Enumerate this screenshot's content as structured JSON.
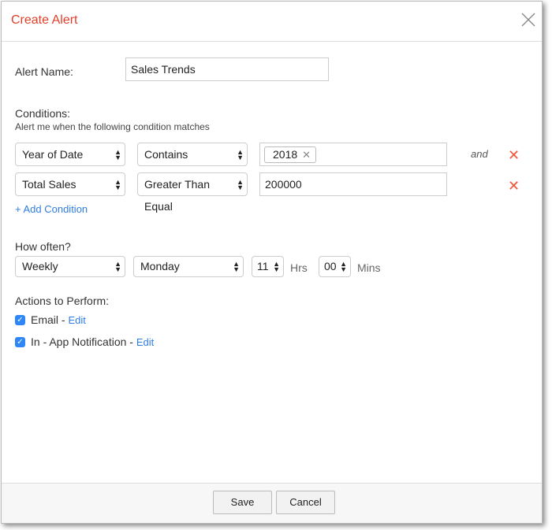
{
  "dialog": {
    "title": "Create Alert"
  },
  "alert_name": {
    "label": "Alert Name:",
    "value": "Sales Trends"
  },
  "conditions": {
    "heading": "Conditions:",
    "subtitle": "Alert me when the following condition matches",
    "rows": [
      {
        "field": "Year of Date",
        "operator": "Contains",
        "tag": "2018",
        "connector": "and"
      },
      {
        "field": "Total Sales",
        "operator": "Greater Than Equal",
        "value": "200000"
      }
    ],
    "add_label": "+ Add Condition"
  },
  "schedule": {
    "heading": "How often?",
    "frequency": "Weekly",
    "day": "Monday",
    "hours": "11",
    "hours_label": "Hrs",
    "minutes": "00",
    "minutes_label": "Mins"
  },
  "actions": {
    "heading": "Actions to Perform:",
    "items": [
      {
        "label": "Email - ",
        "edit": "Edit",
        "checked": true
      },
      {
        "label": "In - App Notification - ",
        "edit": "Edit",
        "checked": true
      }
    ]
  },
  "footer": {
    "save": "Save",
    "cancel": "Cancel"
  }
}
